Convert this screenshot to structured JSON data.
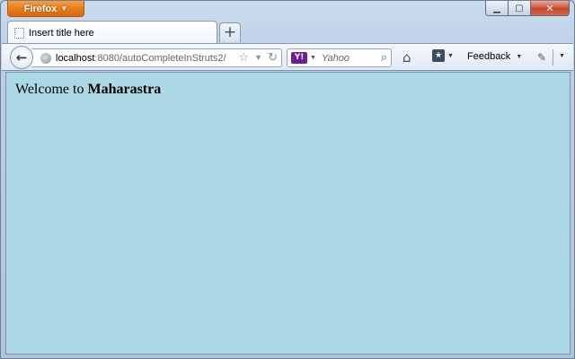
{
  "browser": {
    "menu_button_label": "Firefox",
    "tab_title": "Insert title here",
    "url_host": "localhost",
    "url_rest": ":8080/autoCompleteInStruts2/",
    "search_engine": "Y!",
    "search_placeholder": "Yahoo",
    "feedback_label": "Feedback"
  },
  "page": {
    "welcome_prefix": "Welcome to",
    "state_name": "Maharastra"
  },
  "colors": {
    "content_background": "#add8e6",
    "firefox_orange": "#e7791a"
  },
  "icons": {
    "back": "back-arrow-icon",
    "bookmark_star": "star-icon",
    "reload": "reload-icon",
    "home": "home-icon",
    "search": "search-icon"
  }
}
